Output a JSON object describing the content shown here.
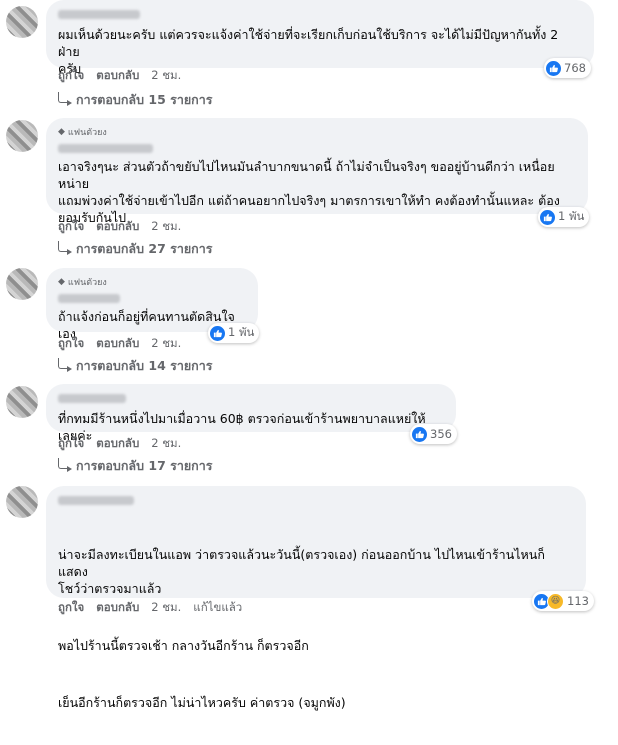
{
  "comments": [
    {
      "text_lines": [
        "ผมเห็นด้วยนะครับ แต่ควรจะแจ้งค่าใช้จ่ายที่จะเรียกเก็บก่อนใช้บริการ จะได้ไม่มีปัญหากันทั้ง 2 ฝ่าย",
        "ครับ"
      ],
      "reaction_count": "768",
      "actions": {
        "like": "ถูกใจ",
        "reply": "ตอบกลับ",
        "time": "2 ชม."
      },
      "replies_label": "การตอบกลับ 15 รายการ"
    },
    {
      "badge": "แฟนตัวยง",
      "text_lines": [
        "เอาจริงๆนะ ส่วนตัวถ้าขยับไปไหนมันลำบากขนาดนี้ ถ้าไม่จำเป็นจริงๆ ขออยู่บ้านดีกว่า เหนื่อยหน่าย",
        "แถมพ่วงค่าใช้จ่ายเข้าไปอีก แต่ถ้าคนอยากไปจริงๆ มาตรการเขาให้ทำ คงต้องทำนั้นแหละ ต้อง",
        "ยอมรับกันไป"
      ],
      "reaction_count": "1 พัน",
      "actions": {
        "like": "ถูกใจ",
        "reply": "ตอบกลับ",
        "time": "2 ชม."
      },
      "replies_label": "การตอบกลับ 27 รายการ"
    },
    {
      "badge": "แฟนตัวยง",
      "text_lines": [
        "ถ้าแจ้งก่อนก็อยู่ที่คนทานตัดสินใจเอง"
      ],
      "reaction_count": "1 พัน",
      "actions": {
        "like": "ถูกใจ",
        "reply": "ตอบกลับ",
        "time": "2 ชม."
      },
      "replies_label": "การตอบกลับ 14 รายการ"
    },
    {
      "text_lines": [
        "ที่กทมมีร้านหนึ่งไปมาเมื่อวาน 60฿ ตรวจก่อนเข้าร้านพยาบาลแหย่ให้เลยค่ะ"
      ],
      "reaction_count": "356",
      "actions": {
        "like": "ถูกใจ",
        "reply": "ตอบกลับ",
        "time": "2 ชม."
      },
      "replies_label": "การตอบกลับ 17 รายการ"
    },
    {
      "paragraphs": [
        "น่าจะมีลงทะเบียนในแอพ ว่าตรวจแล้วนะวันนี้(ตรวจเอง) ก่อนออกบ้าน ไปไหนเข้าร้านไหนก็แสดง\nโชว์ว่าตรวจมาแล้ว",
        "พอไปร้านนี้ตรวจเช้า กลางวันอีกร้าน ก็ตรวจอีก",
        "เย็นอีกร้านก็ตรวจอีก ไม่น่าไหวครับ ค่าตรวจ (จมูกพัง)"
      ],
      "reaction_count": "113",
      "actions": {
        "like": "ถูกใจ",
        "reply": "ตอบกลับ",
        "time": "2 ชม.",
        "edited": "แก้ไขแล้ว"
      }
    }
  ]
}
